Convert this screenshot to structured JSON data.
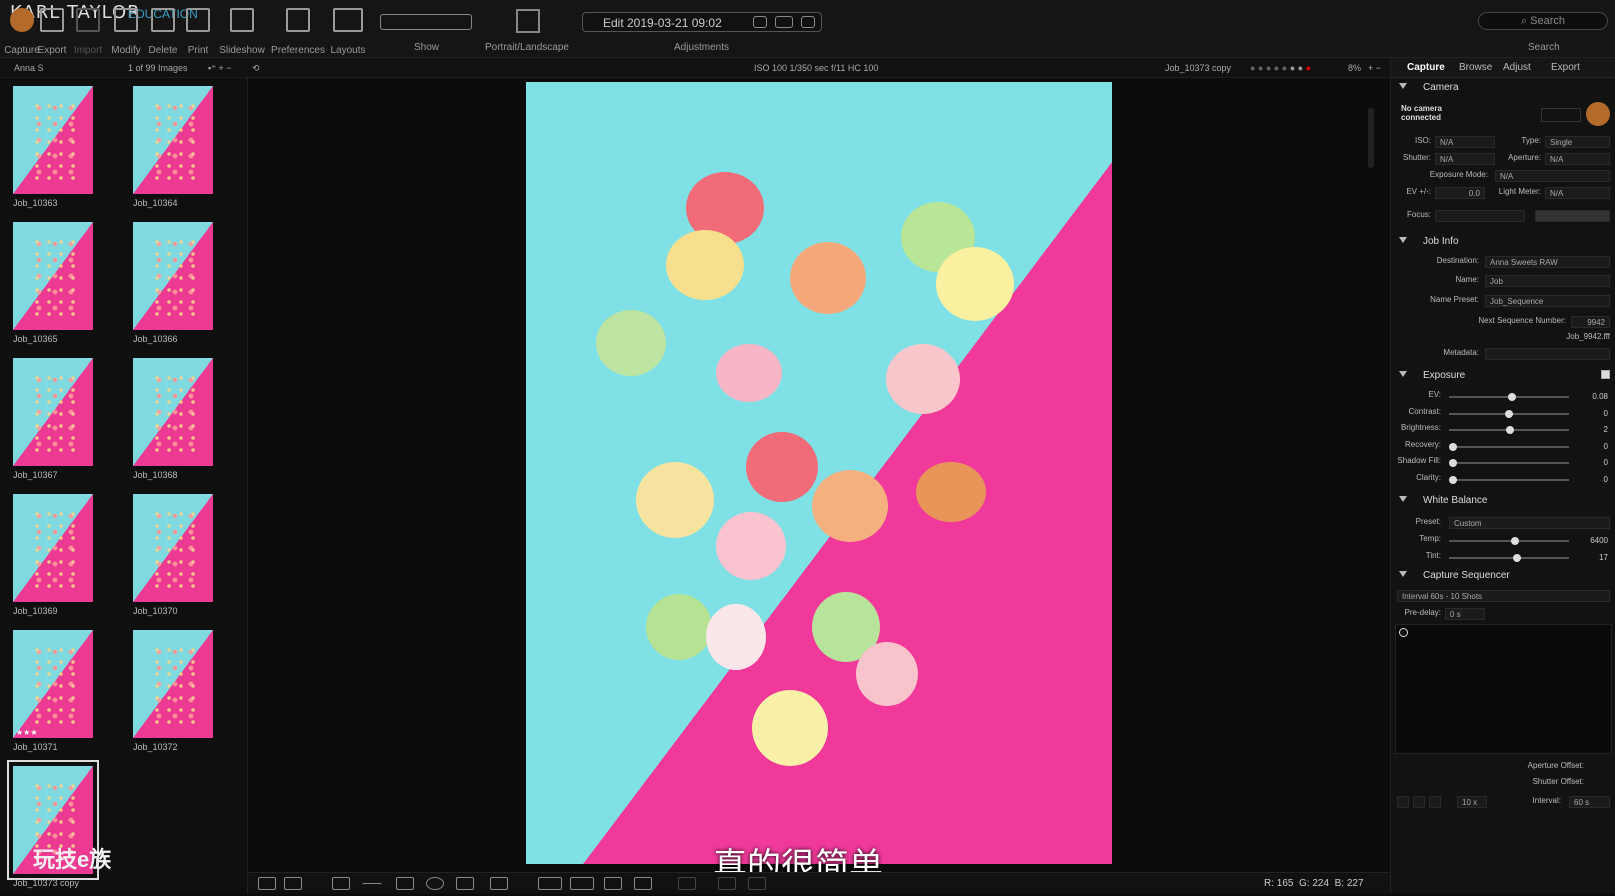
{
  "brand": {
    "name": "KARL TAYLOR",
    "sub": "EDUCATION"
  },
  "toolbar": {
    "items": [
      "Capture",
      "Export",
      "Import",
      "Modify",
      "Delete",
      "Print",
      "Slideshow",
      "Preferences",
      "Layouts"
    ],
    "show_label": "Show",
    "portrait_label": "Portrait/Landscape",
    "adjustments_label": "Adjustments",
    "search_caption": "Search",
    "edit_text": "Edit 2019-03-21 09:02",
    "search_placeholder": "Search"
  },
  "subbar": {
    "album": "Anna S",
    "count": "1 of 99 Images",
    "exif": "ISO 100  1/350 sec  f/11  HC 100",
    "filename": "Job_10373 copy",
    "zoom": "8%"
  },
  "thumbnails": [
    {
      "name": "Job_10363",
      "stars": ""
    },
    {
      "name": "Job_10364",
      "stars": ""
    },
    {
      "name": "Job_10365",
      "stars": ""
    },
    {
      "name": "Job_10366",
      "stars": ""
    },
    {
      "name": "Job_10367",
      "stars": ""
    },
    {
      "name": "Job_10368",
      "stars": ""
    },
    {
      "name": "Job_10369",
      "stars": ""
    },
    {
      "name": "Job_10370",
      "stars": ""
    },
    {
      "name": "Job_10371",
      "stars": "★★★"
    },
    {
      "name": "Job_10372",
      "stars": ""
    },
    {
      "name": "Job_10373 copy",
      "stars": "",
      "selected": true
    }
  ],
  "caption": "真的很简单",
  "watermark": "玩技e族",
  "readout": {
    "r": "R: 165",
    "g": "G: 224",
    "b": "B: 227"
  },
  "panel": {
    "tabs": [
      "Capture",
      "Browse",
      "Adjust",
      "Export"
    ],
    "camera": {
      "title": "Camera",
      "status": "No camera connected",
      "iso_k": "ISO:",
      "iso_v": "N/A",
      "type_k": "Type:",
      "type_v": "Single",
      "shutter_k": "Shutter:",
      "shutter_v": "N/A",
      "aperture_k": "Aperture:",
      "aperture_v": "N/A",
      "mode_k": "Exposure Mode:",
      "mode_v": "N/A",
      "ev_k": "EV +/-:",
      "ev_v": "0.0",
      "meter_k": "Light Meter:",
      "meter_v": "N/A",
      "focus_k": "Focus:"
    },
    "jobinfo": {
      "title": "Job Info",
      "dest_k": "Destination:",
      "dest_v": "Anna Sweets RAW",
      "name_k": "Name:",
      "name_v": "Job",
      "preset_k": "Name Preset:",
      "preset_v": "Job_Sequence",
      "seq_k": "Next Sequence Number:",
      "seq_v": "9942",
      "file_v": "Job_9942.fff",
      "meta_k": "Metadata:"
    },
    "exposure": {
      "title": "Exposure",
      "rows": [
        {
          "label": "EV:",
          "value": "0.08",
          "level": 0.53
        },
        {
          "label": "Contrast:",
          "value": "0",
          "level": 0.5
        },
        {
          "label": "Brightness:",
          "value": "2",
          "level": 0.51
        },
        {
          "label": "Recovery:",
          "value": "0",
          "level": 0.0
        },
        {
          "label": "Shadow Fill:",
          "value": "0",
          "level": 0.0
        },
        {
          "label": "Clarity:",
          "value": "0",
          "level": 0.0
        }
      ]
    },
    "wb": {
      "title": "White Balance",
      "preset_k": "Preset:",
      "preset_v": "Custom",
      "rows": [
        {
          "label": "Temp:",
          "value": "6400",
          "level": 0.55
        },
        {
          "label": "Tint:",
          "value": "17",
          "level": 0.57
        }
      ]
    },
    "seq": {
      "title": "Capture Sequencer",
      "preset_v": "Interval 60s - 10 Shots",
      "predelay_k": "Pre-delay:",
      "predelay_v": "0  s",
      "ap_off_k": "Aperture Offset:",
      "sh_off_k": "Shutter Offset:",
      "shots_v": "10  x",
      "interval_k": "Interval:",
      "interval_v": "60  s"
    }
  }
}
